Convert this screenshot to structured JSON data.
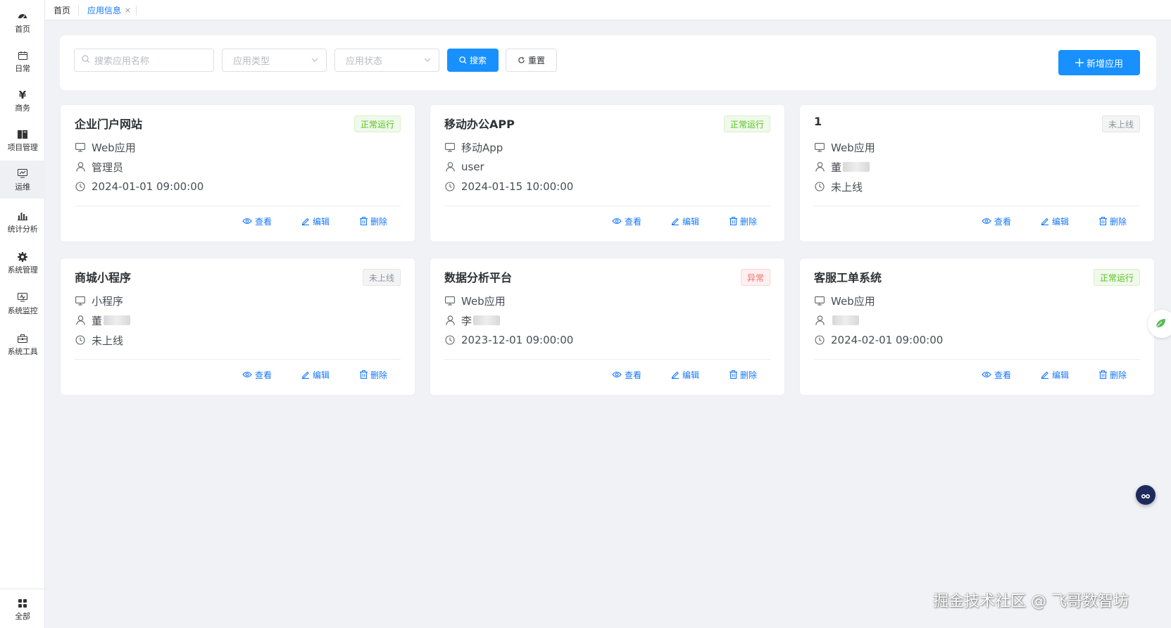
{
  "sidebar": {
    "items": [
      {
        "label": "首页",
        "icon": "dashboard-icon"
      },
      {
        "label": "日常",
        "icon": "calendar-icon"
      },
      {
        "label": "商务",
        "icon": "yen-icon"
      },
      {
        "label": "项目管理",
        "icon": "book-icon"
      },
      {
        "label": "运维",
        "icon": "monitor-chart-icon"
      },
      {
        "label": "统计分析",
        "icon": "bar-chart-icon"
      },
      {
        "label": "系统管理",
        "icon": "gear-icon"
      },
      {
        "label": "系统监控",
        "icon": "monitor-icon"
      },
      {
        "label": "系统工具",
        "icon": "toolbox-icon"
      }
    ],
    "bottom": {
      "label": "全部",
      "icon": "grid-icon"
    }
  },
  "tabs": {
    "home": "首页",
    "current": "应用信息",
    "close": "×"
  },
  "filter": {
    "search_placeholder": "搜索应用名称",
    "type_placeholder": "应用类型",
    "status_placeholder": "应用状态",
    "search_button": "搜索",
    "reset_button": "重置",
    "add_button": "新增应用"
  },
  "actions": {
    "view": "查看",
    "edit": "编辑",
    "delete": "删除"
  },
  "cards": [
    {
      "name": "企业门户网站",
      "status": "正常运行",
      "status_kind": "ok",
      "type": "Web应用",
      "owner": "管理员",
      "owner_blurred": false,
      "time": "2024-01-01 09:00:00"
    },
    {
      "name": "移动办公APP",
      "status": "正常运行",
      "status_kind": "ok",
      "type": "移动App",
      "owner": "user",
      "owner_blurred": false,
      "time": "2024-01-15 10:00:00"
    },
    {
      "name": "1",
      "status": "未上线",
      "status_kind": "off",
      "type": "Web应用",
      "owner": "董",
      "owner_blurred": true,
      "time": "未上线"
    },
    {
      "name": "商城小程序",
      "status": "未上线",
      "status_kind": "off",
      "type": "小程序",
      "owner": "董",
      "owner_blurred": true,
      "time": "未上线"
    },
    {
      "name": "数据分析平台",
      "status": "异常",
      "status_kind": "err",
      "type": "Web应用",
      "owner": "李",
      "owner_blurred": true,
      "time": "2023-12-01 09:00:00"
    },
    {
      "name": "客服工单系统",
      "status": "正常运行",
      "status_kind": "ok",
      "type": "Web应用",
      "owner": "",
      "owner_blurred": true,
      "time": "2024-02-01 09:00:00"
    }
  ],
  "watermark": "掘金技术社区 @ 飞哥数智坊",
  "colors": {
    "primary": "#1890ff",
    "success": "#52c41a",
    "danger": "#f56c6c",
    "muted": "#909399"
  }
}
